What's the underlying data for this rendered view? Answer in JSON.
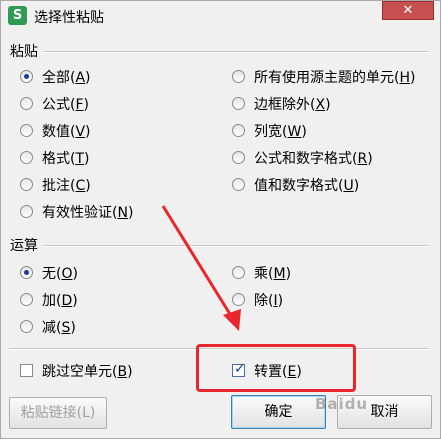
{
  "title": "选择性粘贴",
  "app_icon_glyph": "S",
  "close_glyph": "✕",
  "paste": {
    "label": "粘贴",
    "options": [
      {
        "text": "全部",
        "key": "A",
        "checked": true
      },
      {
        "text": "公式",
        "key": "F",
        "checked": false
      },
      {
        "text": "数值",
        "key": "V",
        "checked": false
      },
      {
        "text": "格式",
        "key": "T",
        "checked": false
      },
      {
        "text": "批注",
        "key": "C",
        "checked": false
      },
      {
        "text": "有效性验证",
        "key": "N",
        "checked": false
      },
      {
        "text": "所有使用源主题的单元",
        "key": "H",
        "checked": false
      },
      {
        "text": "边框除外",
        "key": "X",
        "checked": false
      },
      {
        "text": "列宽",
        "key": "W",
        "checked": false
      },
      {
        "text": "公式和数字格式",
        "key": "R",
        "checked": false
      },
      {
        "text": "值和数字格式",
        "key": "U",
        "checked": false
      }
    ]
  },
  "operation": {
    "label": "运算",
    "options": [
      {
        "text": "无",
        "key": "O",
        "checked": true
      },
      {
        "text": "加",
        "key": "D",
        "checked": false
      },
      {
        "text": "减",
        "key": "S",
        "checked": false
      },
      {
        "text": "乘",
        "key": "M",
        "checked": false
      },
      {
        "text": "除",
        "key": "I",
        "checked": false
      }
    ]
  },
  "skip_blanks": {
    "text": "跳过空单元",
    "key": "B",
    "checked": false
  },
  "transpose": {
    "text": "转置",
    "key": "E",
    "checked": true
  },
  "buttons": {
    "paste_link": "粘贴链接(L)",
    "ok": "确定",
    "cancel": "取消"
  },
  "watermark": "Baidu",
  "colors": {
    "annotation": "#e8262b",
    "accent": "#1c3a9c"
  }
}
